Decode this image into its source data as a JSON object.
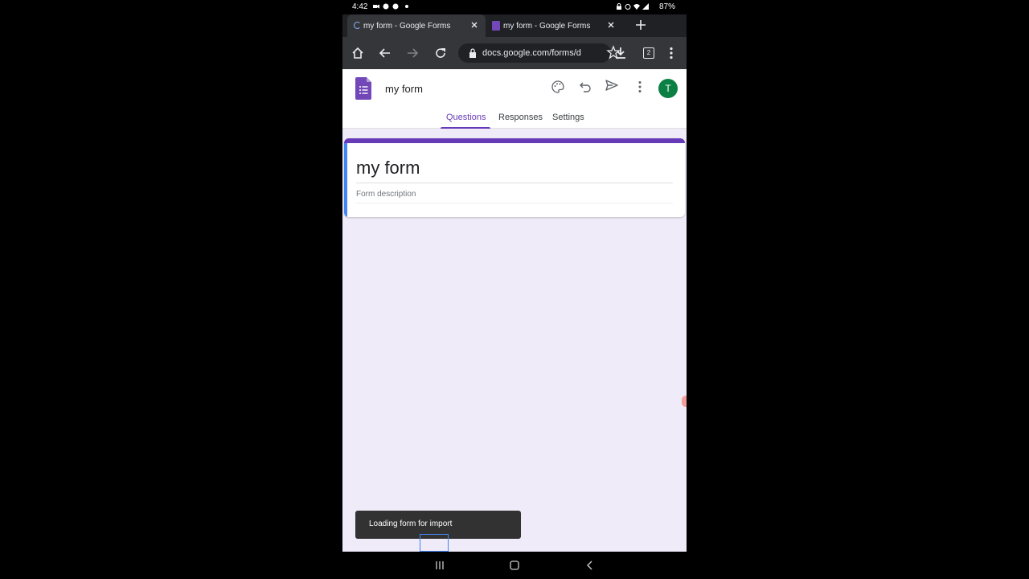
{
  "status_bar": {
    "time": "4:42",
    "battery": "87%"
  },
  "browser": {
    "tabs": [
      {
        "title": "my form - Google Forms",
        "loading": true
      },
      {
        "title": "my form - Google Forms",
        "loading": false
      }
    ],
    "url": "docs.google.com/forms/d",
    "tab_count": "2"
  },
  "forms_header": {
    "form_name": "my form",
    "avatar_letter": "T",
    "tabs": [
      "Questions",
      "Responses",
      "Settings"
    ],
    "active_tab": "Questions"
  },
  "title_card": {
    "title": "my form",
    "description_placeholder": "Form description"
  },
  "snackbar": {
    "message": "Loading form for import"
  },
  "colors": {
    "accent": "#673ab7",
    "page_bg": "#f0ebf8",
    "avatar": "#0b8043",
    "focus_bar": "#4285f4"
  }
}
